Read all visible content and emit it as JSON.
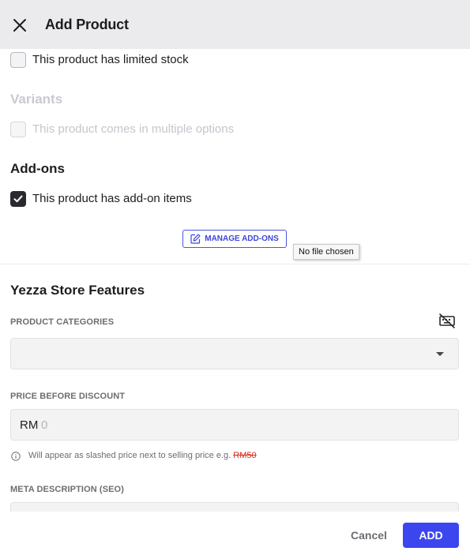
{
  "header": {
    "title": "Add Product",
    "close_icon": "close-icon"
  },
  "stock": {
    "label": "This product has limited stock",
    "checked": false
  },
  "variants": {
    "title": "Variants",
    "label": "This product comes in multiple options",
    "checked": false,
    "disabled": true
  },
  "addons": {
    "title": "Add-ons",
    "label": "This product has add-on items",
    "checked": true,
    "manage_button": "MANAGE ADD-ONS",
    "manage_icon": "edit-icon",
    "tooltip": "No file chosen"
  },
  "features": {
    "title": "Yezza Store Features",
    "categories": {
      "label": "PRODUCT CATEGORIES",
      "value": "",
      "icon": "keyboard-off-icon"
    },
    "price": {
      "label": "PRICE BEFORE DISCOUNT",
      "prefix": "RM",
      "placeholder": "0",
      "hint": "Will appear as slashed price next to selling price e.g. ",
      "hint_example": "RM50"
    },
    "meta": {
      "label": "META DESCRIPTION (SEO)"
    }
  },
  "footer": {
    "cancel": "Cancel",
    "add": "ADD"
  },
  "colors": {
    "accent": "#3c46ef",
    "header_bg": "#ebebee",
    "strike": "#e0281e"
  }
}
